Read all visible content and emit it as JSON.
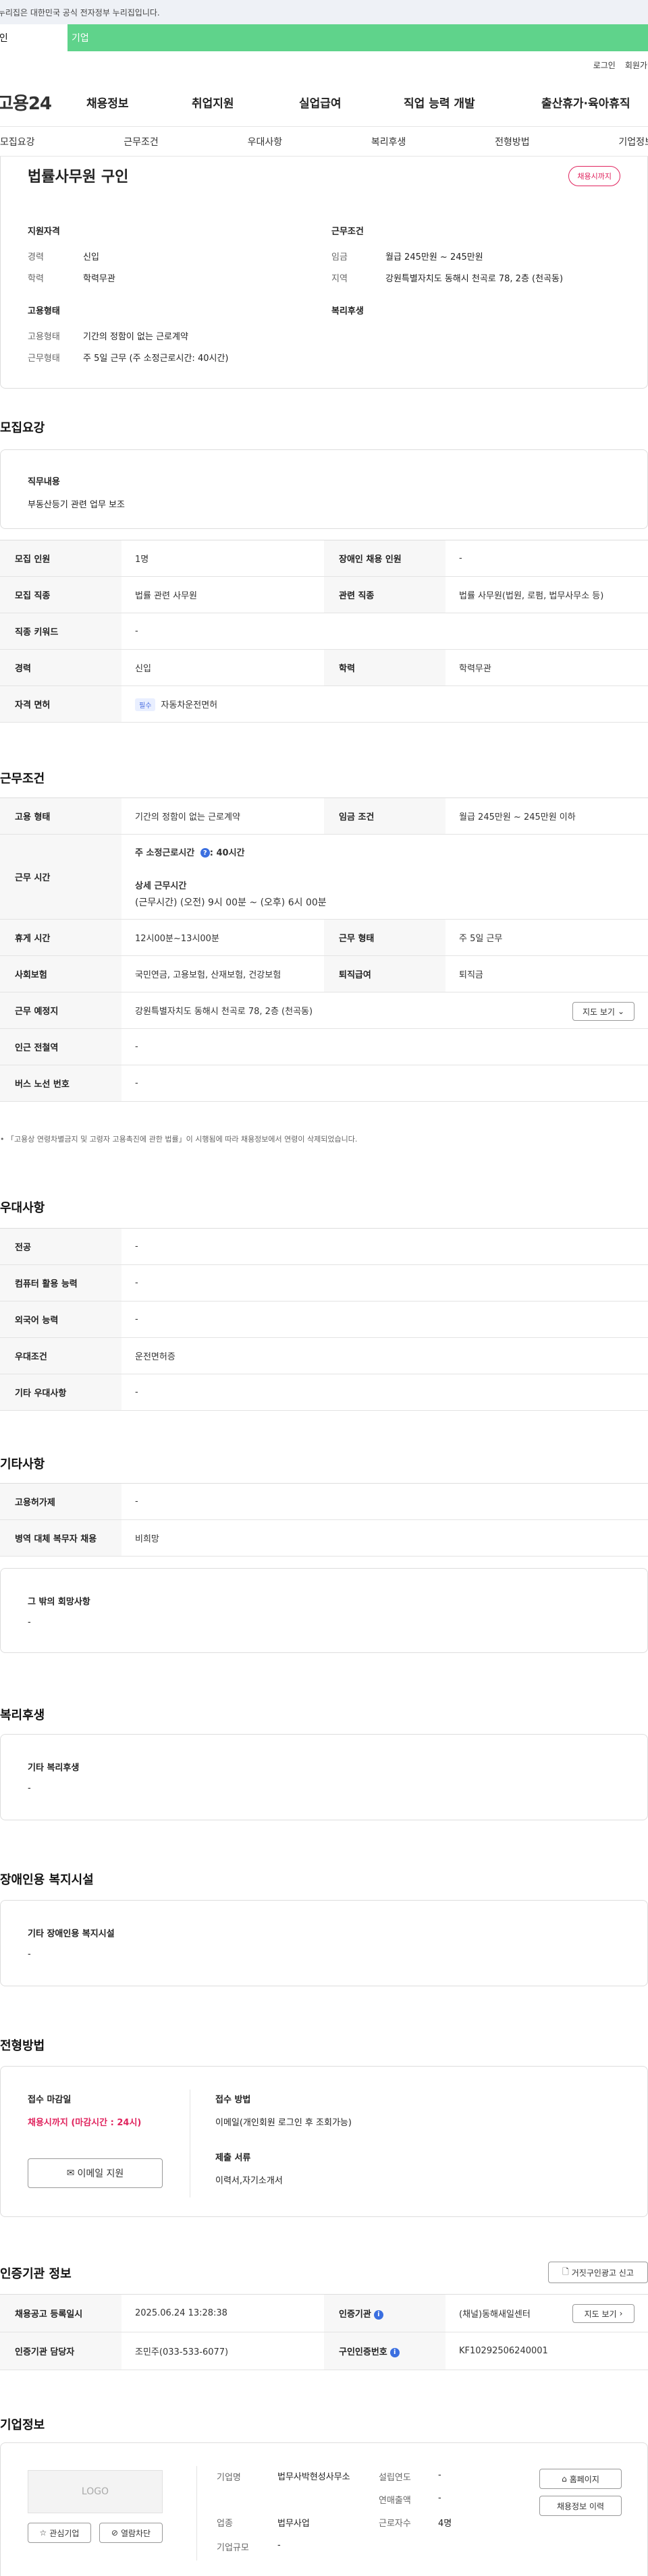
{
  "gov_banner": "이 누리집은 대한민국 공식 전자정부 누리집입니다.",
  "tabs": {
    "personal": "개인",
    "company": "기업"
  },
  "util": {
    "login": "로그인",
    "join": "회원가입"
  },
  "logo": "고용24",
  "gnb": [
    "채용정보",
    "취업지원",
    "실업급여",
    "직업 능력 개발",
    "출산휴가·육아휴직"
  ],
  "subnav": [
    "모집요강",
    "근무조건",
    "우대사항",
    "복리후생",
    "전형방법",
    "기업정보"
  ],
  "summary": {
    "title": "법률사무원 구인",
    "status": "채용시까지",
    "qual_title": "지원자격",
    "qual": [
      {
        "k": "경력",
        "v": "신입"
      },
      {
        "k": "학력",
        "v": "학력무관"
      }
    ],
    "cond_title": "근무조건",
    "cond": [
      {
        "k": "임금",
        "v": "월급 245만원 ~ 245만원"
      },
      {
        "k": "지역",
        "v": "강원특별자치도 동해시 천곡로 78, 2층 (천곡동)"
      }
    ],
    "emp_title": "고용형태",
    "emp": [
      {
        "k": "고용형태",
        "v": "기간의 정함이 없는 근로계약"
      },
      {
        "k": "근무형태",
        "v": "주 5일 근무 (주 소정근로시간: 40시간)"
      }
    ],
    "welfare_title": "복리후생"
  },
  "recruit": {
    "title": "모집요강",
    "duty_label": "직무내용",
    "duty_value": "부동산등기 관련 업무 보조",
    "rows": {
      "headcount_k": "모집 인원",
      "headcount_v": "1명",
      "disabled_k": "장애인 채용 인원",
      "disabled_v": "-",
      "job_k": "모집 직종",
      "job_v": "법률 관련 사무원",
      "related_k": "관련 직종",
      "related_v": "법률 사무원(법원, 로펌, 법무사무소 등)",
      "keyword_k": "직종 키워드",
      "keyword_v": "-",
      "career_k": "경력",
      "career_v": "신입",
      "edu_k": "학력",
      "edu_v": "학력무관",
      "license_k": "자격 면허",
      "license_badge": "필수",
      "license_v": "자동차운전면허"
    }
  },
  "work": {
    "title": "근무조건",
    "emp_k": "고용 형태",
    "emp_v": "기간의 정함이 없는 근로계약",
    "wage_k": "임금 조건",
    "wage_v": "월급 245만원 ~ 245만원 이하",
    "hours_k": "근무 시간",
    "hours_weekly_label": "주 소정근로시간",
    "hours_weekly_value": ": 40시간",
    "hours_detail_label": "상세 근무시간",
    "hours_detail_value": "(근무시간) (오전) 9시 00분 ~ (오후) 6시 00분",
    "break_k": "휴게 시간",
    "break_v": "12시00분~13시00분",
    "type_k": "근무 형태",
    "type_v": "주 5일 근무",
    "insurance_k": "사회보험",
    "insurance_v": "국민연금, 고용보험, 산재보험, 건강보험",
    "severance_k": "퇴직급여",
    "severance_v": "퇴직금",
    "place_k": "근무 예정지",
    "place_v": "강원특별자치도 동해시 천곡로 78, 2층 (천곡동)",
    "map_btn": "지도 보기",
    "subway_k": "인근 전철역",
    "subway_v": "-",
    "bus_k": "버스 노선 번호",
    "bus_v": "-",
    "footnote": "「고용상 연령차별금지 및 고령자 고용촉진에 관한 법률」이 시행됨에 따라 채용정보에서 연령이 삭제되었습니다."
  },
  "prefer": {
    "title": "우대사항",
    "rows": [
      {
        "k": "전공",
        "v": "-"
      },
      {
        "k": "컴퓨터 활용 능력",
        "v": "-"
      },
      {
        "k": "외국어 능력",
        "v": "-"
      },
      {
        "k": "우대조건",
        "v": "운전면허증"
      },
      {
        "k": "기타 우대사항",
        "v": "-"
      }
    ]
  },
  "etc": {
    "title": "기타사항",
    "rows": [
      {
        "k": "고용허가제",
        "v": "-"
      },
      {
        "k": "병역 대체 복무자 채용",
        "v": "비희망"
      }
    ],
    "other_label": "그 밖의 회망사항",
    "other_value": "-"
  },
  "welfare": {
    "title": "복리후생",
    "label": "기타 복리후생",
    "value": "-"
  },
  "disability": {
    "title": "장애인용 복지시설",
    "label": "기타 장애인용 복지시설",
    "value": "-"
  },
  "selection": {
    "title": "전형방법",
    "deadline_label": "접수 마감일",
    "deadline_value": "채용시까지 (마감시간 : 24시)",
    "email_btn": "이메일 지원",
    "method_label": "접수 방법",
    "method_value": "이메일(개인회원 로그인 후 조회가능)",
    "docs_label": "제출 서류",
    "docs_value": "이력서,자기소개서"
  },
  "cert": {
    "title": "인증기관 정보",
    "report_btn": "거짓구인광고 신고",
    "date_k": "채용공고 등록일시",
    "date_v": "2025.06.24 13:28:38",
    "org_k": "인증기관",
    "org_v": "(채널)동해새일센터",
    "map_btn": "지도 보기",
    "person_k": "인증기관 담당자",
    "person_v": "조민주(033-533-6077)",
    "cert_no_k": "구인인증번호",
    "cert_no_v": "KF10292506240001"
  },
  "company": {
    "title": "기업정보",
    "logo_text": "LOGO",
    "interest_btn": "관심기업",
    "block_btn": "열람차단",
    "name_k": "기업명",
    "name_v": "법무사박현성사무소",
    "industry_k": "업종",
    "industry_v": "법무사업",
    "scale_k": "기업규모",
    "scale_v": "-",
    "founded_k": "설립연도",
    "founded_v": "-",
    "revenue_k": "연매출액",
    "revenue_v": "-",
    "employees_k": "근로자수",
    "employees_v": "4명",
    "homepage_btn": "홈페이지",
    "history_btn": "채용정보 이력"
  }
}
